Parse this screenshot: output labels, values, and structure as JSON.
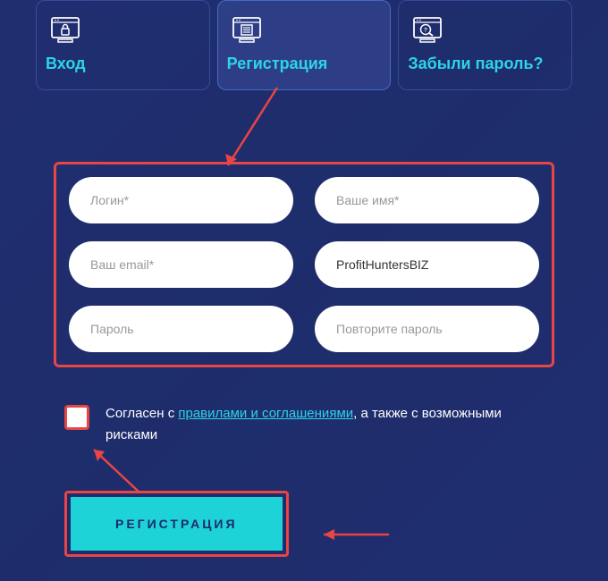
{
  "tabs": {
    "login": {
      "label": "Вход"
    },
    "register": {
      "label": "Регистрация"
    },
    "forgot": {
      "label": "Забыли пароль?"
    }
  },
  "form": {
    "login_placeholder": "Логин*",
    "name_placeholder": "Ваше имя*",
    "email_placeholder": "Ваш email*",
    "referrer_value": "ProfitHuntersBIZ",
    "password_placeholder": "Пароль",
    "password_repeat_placeholder": "Повторите пароль"
  },
  "consent": {
    "prefix": "Согласен с ",
    "link": "правилами и соглашениями",
    "suffix": ", а также с возможными рисками"
  },
  "submit": {
    "label": "РЕГИСТРАЦИЯ"
  }
}
